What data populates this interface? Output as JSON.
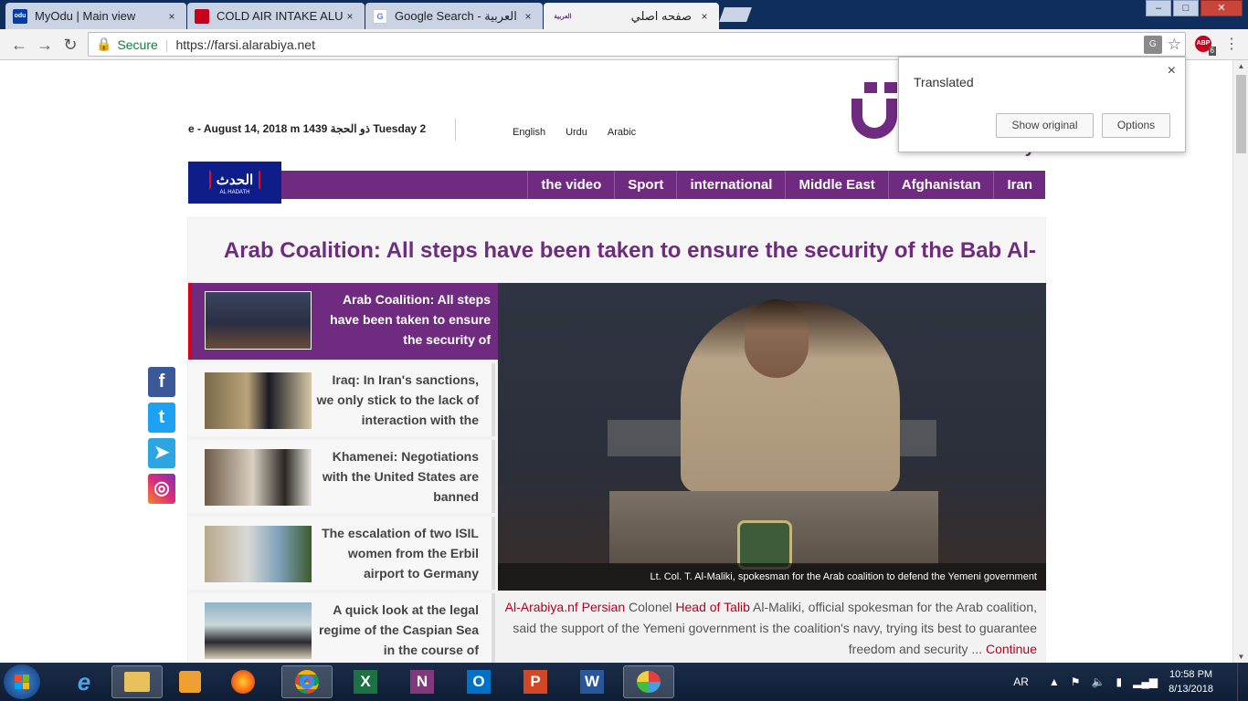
{
  "browser": {
    "tabs": [
      {
        "title": "MyOdu | Main view",
        "icon": "odu-icon",
        "close": "×",
        "icon_text": "odu"
      },
      {
        "title": "COLD AIR INTAKE ALUMI",
        "icon": "cart-icon",
        "close": "×",
        "icon_text": ""
      },
      {
        "title": "Google Search - العربية",
        "icon": "google-icon",
        "close": "×",
        "icon_text": "G"
      },
      {
        "title": "صفحه اصلي",
        "icon": "alarabiya-icon",
        "close": "×",
        "icon_text": "العربية"
      }
    ],
    "window_buttons": {
      "minimize": "–",
      "maximize": "□",
      "close": "✕"
    },
    "secure_label": "Secure",
    "url": "https://farsi.alarabiya.net",
    "translate_icon_text": "G",
    "abp_badge": "6",
    "abp_text": "ABP"
  },
  "translate_popup": {
    "title": "Translated",
    "show_original": "Show original",
    "options": "Options",
    "close": "×"
  },
  "header": {
    "date": "e - August 14, 2018 m 1439 ذو الحجة Tuesday 2",
    "languages": [
      "English",
      "Urdu",
      "Arabic"
    ],
    "logo_text": "Al Arabiya"
  },
  "nav": {
    "hadath_ar": "الحدث",
    "hadath_en": "AL HADATH",
    "items": [
      "the video",
      "Sport",
      "international",
      "Middle East",
      "Afghanistan",
      "Iran"
    ]
  },
  "main": {
    "headline": "Arab Coalition: All steps have been taken to ensure the security of the Bab Al-",
    "stories": [
      "Arab Coalition: All steps have been taken to ensure the security of",
      "Iraq: In Iran's sanctions, we only stick to the lack of interaction with the",
      "Khamenei: Negotiations with the United States are banned",
      "The escalation of two ISIL women from the Erbil airport to Germany",
      "A quick look at the legal regime of the Caspian Sea in the course of"
    ],
    "caption": "Lt. Col. T. Al-Maliki, spokesman for the Arab coalition to defend the Yemeni government",
    "excerpt_source": "Al-Arabiya.nf Persian",
    "excerpt_colonel": "Colonel",
    "excerpt_head": "Head of Talib",
    "excerpt_body": "Al-Maliki, official spokesman for the Arab coalition, said the support of the Yemeni government is the coalition's navy, trying its best to guarantee freedom and security ...",
    "excerpt_continue": "Continue"
  },
  "social": [
    "f",
    "t",
    "➤",
    "◎"
  ],
  "taskbar": {
    "language": "AR",
    "time": "10:58 PM",
    "date": "8/13/2018",
    "apps": [
      "e",
      "X",
      "N",
      "O",
      "P",
      "W"
    ]
  },
  "colors": {
    "brand_purple": "#6f2b7f",
    "accent_red": "#b8001c",
    "hadath_blue": "#0d1d8a"
  }
}
